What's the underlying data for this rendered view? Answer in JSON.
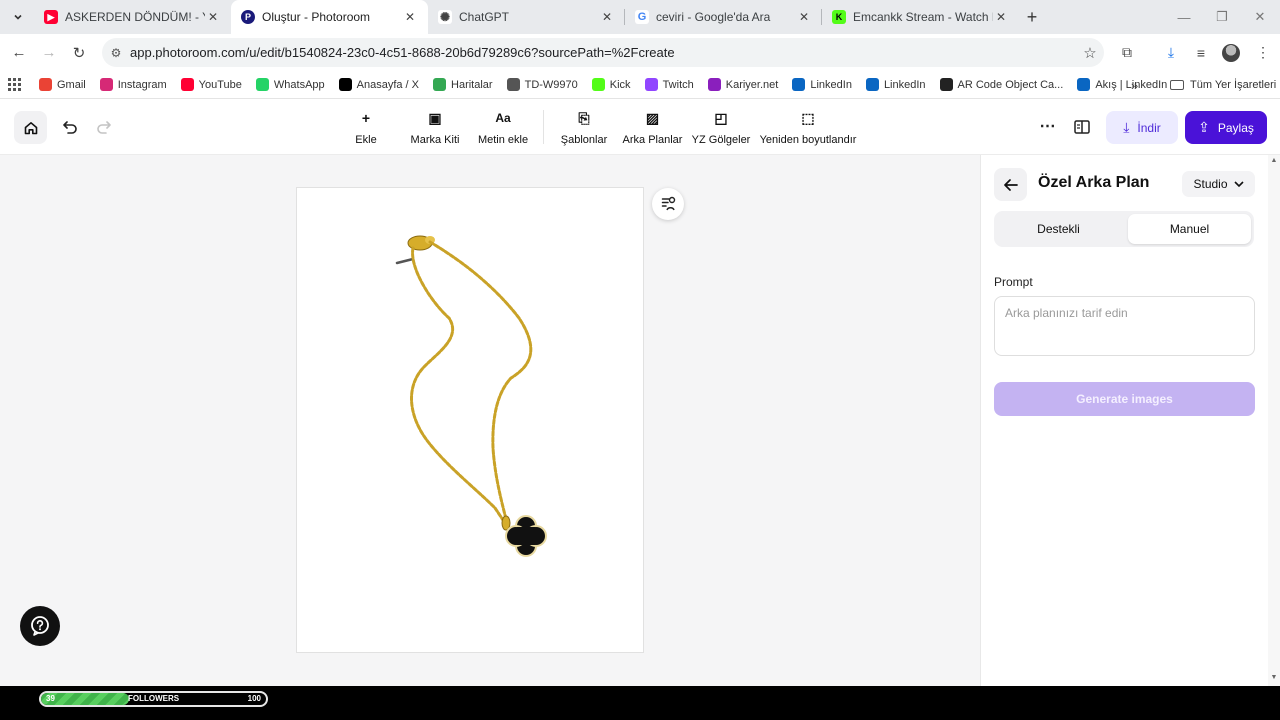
{
  "browser": {
    "tabs": [
      {
        "title": "ASKERDEN DÖNDÜM! - YouTube",
        "favicon": "youtube-icon",
        "color": "#ff0033",
        "active": false
      },
      {
        "title": "Oluştur - Photoroom",
        "favicon": "photoroom-icon",
        "color": "#1a1a7a",
        "active": true
      },
      {
        "title": "ChatGPT",
        "favicon": "chatgpt-icon",
        "color": "#444444",
        "active": false
      },
      {
        "title": "ceviri - Google'da Ara",
        "favicon": "google-icon",
        "color": "#4285f4",
        "active": false
      },
      {
        "title": "Emcankk Stream - Watch Live o",
        "favicon": "kick-icon",
        "color": "#53fc18",
        "active": false
      }
    ],
    "url": "app.photoroom.com/u/edit/b1540824-23c0-4c51-8688-20b6d79289c6?sourcePath=%2Fcreate",
    "bookmarks": [
      {
        "label": "Gmail",
        "icon": "gmail-icon",
        "color": "#ea4335"
      },
      {
        "label": "Instagram",
        "icon": "instagram-icon",
        "color": "#d62976"
      },
      {
        "label": "YouTube",
        "icon": "youtube-icon",
        "color": "#ff0033"
      },
      {
        "label": "WhatsApp",
        "icon": "whatsapp-icon",
        "color": "#25d366"
      },
      {
        "label": "Anasayfa / X",
        "icon": "x-icon",
        "color": "#000000"
      },
      {
        "label": "Haritalar",
        "icon": "maps-icon",
        "color": "#34a853"
      },
      {
        "label": "TD-W9970",
        "icon": "router-icon",
        "color": "#555555"
      },
      {
        "label": "Kick",
        "icon": "kick-icon",
        "color": "#53fc18"
      },
      {
        "label": "Twitch",
        "icon": "twitch-icon",
        "color": "#9146ff"
      },
      {
        "label": "Kariyer.net",
        "icon": "kariyer-icon",
        "color": "#8a1fbd"
      },
      {
        "label": "LinkedIn",
        "icon": "linkedin-icon",
        "color": "#0a66c2"
      },
      {
        "label": "LinkedIn",
        "icon": "linkedin-icon",
        "color": "#0a66c2"
      },
      {
        "label": "AR Code Object Ca...",
        "icon": "qr-icon",
        "color": "#222222"
      },
      {
        "label": "Akış | LinkedIn",
        "icon": "linkedin-icon",
        "color": "#0a66c2"
      }
    ],
    "more_bookmarks": "»",
    "all_bookmarks": "Tüm Yer İşaretleri"
  },
  "app": {
    "tools": [
      {
        "label": "Ekle",
        "icon": "plus-icon",
        "glyph": "+"
      },
      {
        "label": "Marka Kiti",
        "icon": "brand-kit-icon",
        "glyph": "▣"
      },
      {
        "label": "Metin ekle",
        "icon": "text-icon",
        "glyph": "Aa"
      },
      {
        "label": "Şablonlar",
        "icon": "templates-icon",
        "glyph": "⎘"
      },
      {
        "label": "Arka Planlar",
        "icon": "backgrounds-icon",
        "glyph": "▨"
      },
      {
        "label": "YZ Gölgeler",
        "icon": "ai-shadows-icon",
        "glyph": "◰"
      },
      {
        "label": "Yeniden boyutlandır",
        "icon": "resize-icon",
        "glyph": "⬚"
      }
    ],
    "download_label": "İndir",
    "share_label": "Paylaş"
  },
  "panel": {
    "title": "Özel Arka Plan",
    "studio_label": "Studio",
    "segments": [
      "Destekli",
      "Manuel"
    ],
    "active_segment": "Manuel",
    "prompt_label": "Prompt",
    "prompt_placeholder": "Arka planınızı tarif edin",
    "prompt_value": "",
    "generate_label": "Generate images"
  },
  "overlay": {
    "followers_current": "39",
    "followers_label": "FOLLOWERS",
    "followers_goal": "100",
    "progress": 0.39
  },
  "colors": {
    "accent": "#4a12d8",
    "accent_soft": "#ecebff",
    "generate_disabled": "#c4b3f2",
    "chain_gold": "#c9a227",
    "pendant": "#111111"
  }
}
